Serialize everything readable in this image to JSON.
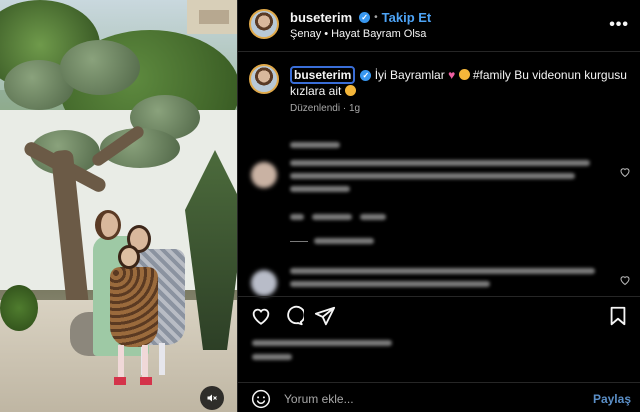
{
  "post": {
    "username": "buseterim",
    "follow_label": "Takip Et",
    "dot": "•",
    "sub_name": "Şenay",
    "sub_dot": "•",
    "sub_song": "Hayat Bayram Olsa",
    "more_label": "•••"
  },
  "caption": {
    "username": "buseterim",
    "text_part1": "İyi Bayramlar ",
    "text_part2": " #family Bu videonun kurgusu kızlara ait ",
    "edited_label": "Düzenlendi",
    "dot": "·",
    "time": "1g"
  },
  "comment_box": {
    "placeholder": "Yorum ekle...",
    "post_label": "Paylaş"
  },
  "icons": {
    "verified": "verified-badge-icon",
    "heart": "heart-icon",
    "comment": "comment-icon",
    "share": "share-icon",
    "save": "bookmark-icon",
    "emoji": "smile-icon",
    "mute": "mute-icon"
  },
  "colors": {
    "accent": "#4da3f5",
    "verified": "#3897f0",
    "background": "#000000",
    "text": "#f5f5f5",
    "muted": "#a8a8a8"
  }
}
